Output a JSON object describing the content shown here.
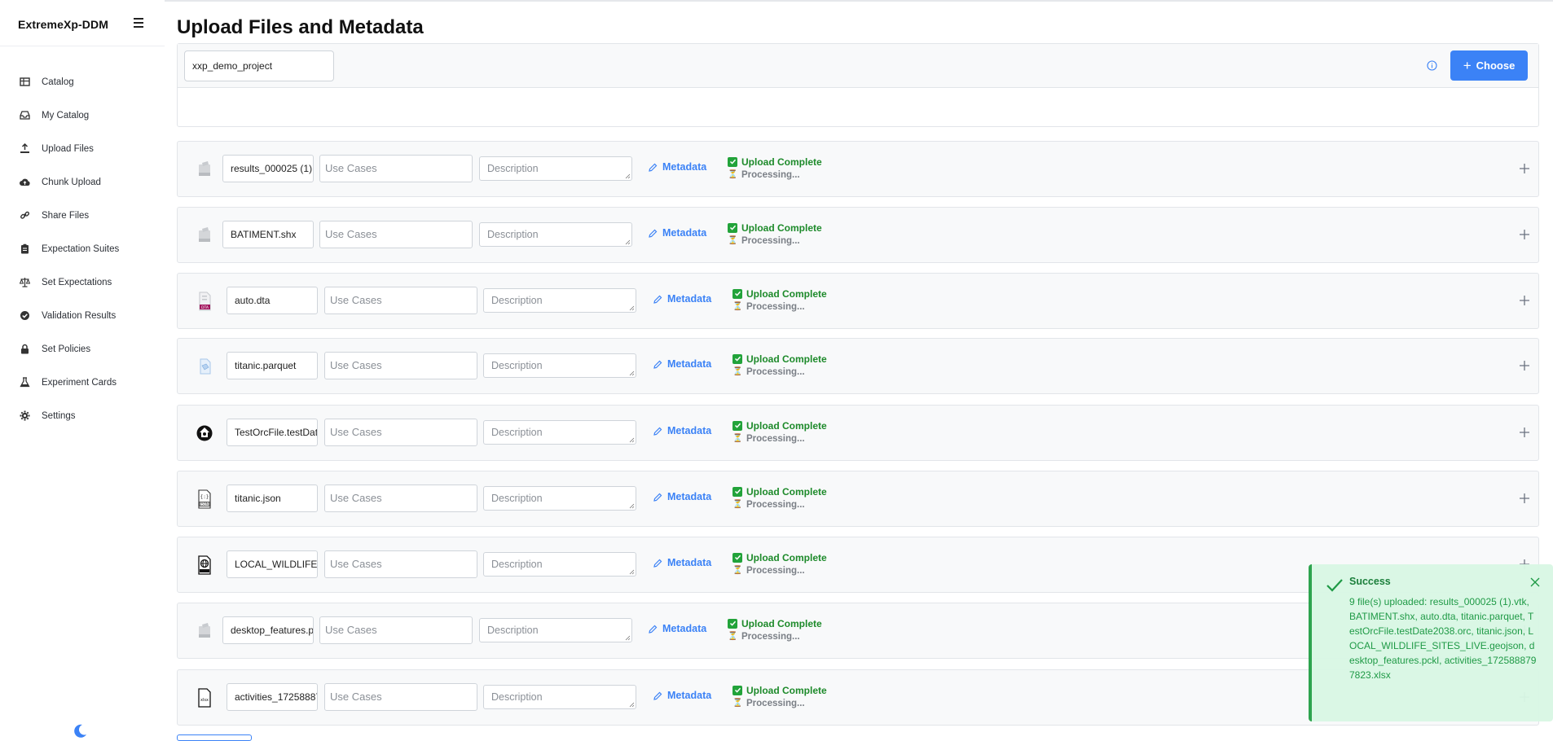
{
  "app": {
    "brand": "ExtremeXp-DDM"
  },
  "sidebar": {
    "items": [
      {
        "label": "Catalog",
        "icon": "table-icon"
      },
      {
        "label": "My Catalog",
        "icon": "inbox-icon"
      },
      {
        "label": "Upload Files",
        "icon": "upload-icon"
      },
      {
        "label": "Chunk Upload",
        "icon": "cloud-upload-icon"
      },
      {
        "label": "Share Files",
        "icon": "link-icon"
      },
      {
        "label": "Expectation Suites",
        "icon": "clipboard-icon"
      },
      {
        "label": "Set Expectations",
        "icon": "scale-icon"
      },
      {
        "label": "Validation Results",
        "icon": "check-circle-icon"
      },
      {
        "label": "Set Policies",
        "icon": "lock-icon"
      },
      {
        "label": "Experiment Cards",
        "icon": "flask-icon"
      },
      {
        "label": "Settings",
        "icon": "gear-icon"
      }
    ]
  },
  "main": {
    "title": "Upload Files and Metadata",
    "project_input": "xxp_demo_project",
    "choose_label": "Choose",
    "use_cases_placeholder": "Use Cases",
    "description_placeholder": "Description",
    "metadata_label": "Metadata",
    "upload_complete_label": "Upload Complete",
    "processing_label": "Processing...",
    "files": [
      {
        "name": "results_000025 (1).vtk",
        "icon": "generic-file-icon"
      },
      {
        "name": "BATIMENT.shx",
        "icon": "generic-file-icon"
      },
      {
        "name": "auto.dta",
        "icon": "dta-file-icon"
      },
      {
        "name": "titanic.parquet",
        "icon": "parquet-file-icon"
      },
      {
        "name": "TestOrcFile.testDate2038.orc",
        "icon": "orc-file-icon"
      },
      {
        "name": "titanic.json",
        "icon": "json-file-icon"
      },
      {
        "name": "LOCAL_WILDLIFE_SITES_LIVE.geojson",
        "icon": "geojson-file-icon"
      },
      {
        "name": "desktop_features.pckl",
        "icon": "generic-file-icon"
      },
      {
        "name": "activities_1725888797823.xlsx",
        "icon": "xlsx-file-icon"
      }
    ]
  },
  "toast": {
    "title": "Success",
    "message": "9 file(s) uploaded: results_000025 (1).vtk, BATIMENT.shx, auto.dta, titanic.parquet, TestOrcFile.testDate2038.orc, titanic.json, LOCAL_WILDLIFE_SITES_LIVE.geojson, desktop_features.pckl, activities_1725888797823.xlsx"
  },
  "colors": {
    "accent": "#3b82f6",
    "success": "#1d8a2a",
    "toast_bg": "#d9f7e4"
  }
}
